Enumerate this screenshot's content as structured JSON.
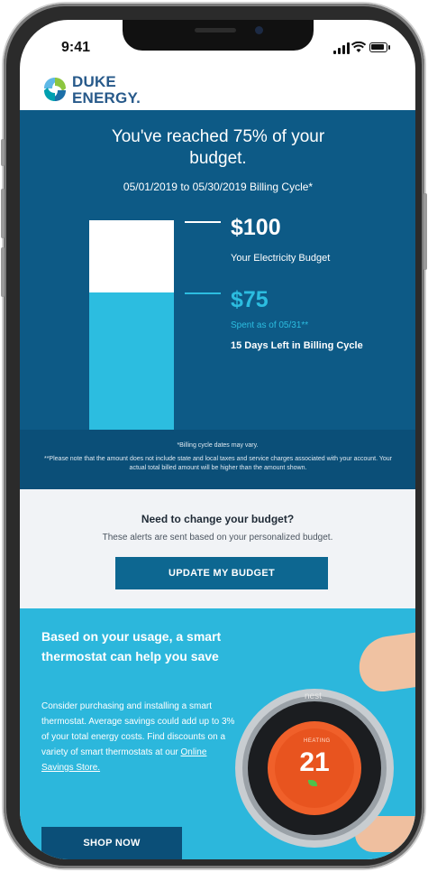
{
  "status_bar": {
    "time": "9:41"
  },
  "logo": {
    "line1": "DUKE",
    "line2": "ENERGY."
  },
  "budget": {
    "alert_title": "You've reached 75% of your budget.",
    "billing_cycle": "05/01/2019 to 05/30/2019 Billing Cycle*",
    "budget_amount": "$100",
    "budget_label": "Your Electricity Budget",
    "spent_amount": "$75",
    "spent_label": "Spent as of 05/31**",
    "days_left": "15 Days Left in Billing Cycle",
    "spent_fraction": 0.75,
    "disclaimer_1": "*Billing cycle dates may vary.",
    "disclaimer_2": "**Please note that the amount does not include state and local taxes and service charges associated with your account. Your actual total billed amount will be higher than the amount shown."
  },
  "change_budget": {
    "title": "Need to change your budget?",
    "subtitle": "These alerts are sent based on your personalized budget.",
    "button_label": "UPDATE MY BUDGET"
  },
  "promo": {
    "title": "Based on your usage, a smart thermostat can help you save",
    "body": "Consider purchasing and installing a smart thermostat. Average savings could add up to 3% of your total energy costs. Find discounts on a variety of smart thermostats at our",
    "link_label": "Online Savings Store.",
    "button_label": "SHOP NOW",
    "thermostat_brand": "nest",
    "thermostat_mode": "HEATING",
    "thermostat_temp": "21"
  },
  "colors": {
    "budget_bg": "#0d5a86",
    "accent_cyan": "#2cbde0",
    "promo_bg": "#2cb7dc",
    "button_blue": "#0d6791"
  },
  "icons": [
    "duke-energy-logo-icon",
    "cellular-signal-icon",
    "wifi-icon",
    "battery-icon",
    "leaf-icon"
  ]
}
